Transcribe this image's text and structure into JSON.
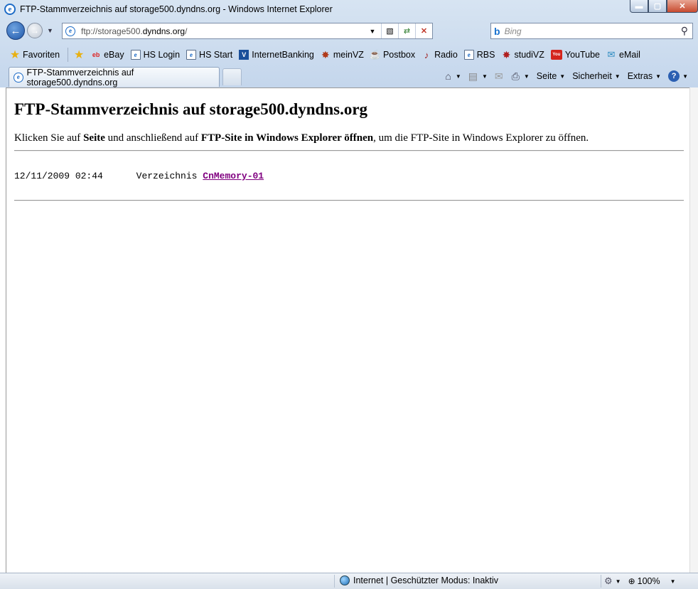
{
  "window": {
    "title": "FTP-Stammverzeichnis auf storage500.dyndns.org - Windows Internet Explorer",
    "min_glyph": "▬",
    "max_glyph": "▢",
    "close_glyph": "✕"
  },
  "address": {
    "url_prefix": "ftp://storage500.",
    "url_domain": "dyndns.org",
    "url_suffix": "/",
    "search_placeholder": "Bing",
    "search_brand": "b"
  },
  "favorites": {
    "favorites_label": "Favoriten",
    "items": [
      {
        "label": "eBay",
        "icon": "ebay-icon"
      },
      {
        "label": "HS Login",
        "icon": "page-icon"
      },
      {
        "label": "HS Start",
        "icon": "page-icon"
      },
      {
        "label": "InternetBanking",
        "icon": "bank-icon"
      },
      {
        "label": "meinVZ",
        "icon": "gear-icon"
      },
      {
        "label": "Postbox",
        "icon": "java-icon"
      },
      {
        "label": "Radio",
        "icon": "guitar-icon"
      },
      {
        "label": "RBS",
        "icon": "page-icon"
      },
      {
        "label": "studiVZ",
        "icon": "gear-icon"
      },
      {
        "label": "YouTube",
        "icon": "youtube-icon"
      },
      {
        "label": "eMail",
        "icon": "mail-icon"
      }
    ]
  },
  "tabs": [
    {
      "label": "FTP-Stammverzeichnis auf storage500.dyndns.org"
    }
  ],
  "commands": {
    "page": "Seite",
    "safety": "Sicherheit",
    "tools": "Extras",
    "help": "?"
  },
  "content": {
    "heading": "FTP-Stammverzeichnis auf storage500.dyndns.org",
    "intro_1": "Klicken Sie auf ",
    "intro_bold_1": "Seite",
    "intro_2": " und anschließend auf ",
    "intro_bold_2": "FTP-Site in Windows Explorer öffnen",
    "intro_3": ", um die FTP-Site in Windows Explorer zu öffnen.",
    "entries": [
      {
        "date": "12/11/2009 02:44",
        "type": "Verzeichnis",
        "name": "CnMemory-01"
      }
    ]
  },
  "status": {
    "zone": "Internet | Geschützter Modus: Inaktiv",
    "zoom": "100%"
  }
}
